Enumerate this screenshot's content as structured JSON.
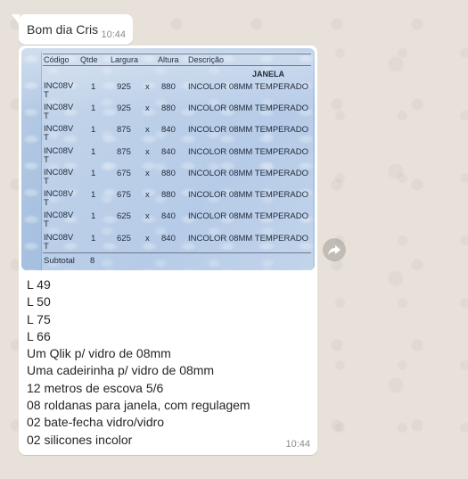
{
  "messages": [
    {
      "text": "Bom dia Cris",
      "time": "10:44"
    },
    {
      "image": {
        "headers": [
          "Código",
          "Qtde",
          "Largura",
          "Altura",
          "Descrição"
        ],
        "group_label": "JANELA",
        "rows": [
          {
            "code_line1": "INC08V",
            "code_line2": "T",
            "qty": "1",
            "width": "925",
            "x": "x",
            "height": "880",
            "desc": "INCOLOR 08MM TEMPERADO"
          },
          {
            "code_line1": "INC08V",
            "code_line2": "T",
            "qty": "1",
            "width": "925",
            "x": "x",
            "height": "880",
            "desc": "INCOLOR 08MM TEMPERADO"
          },
          {
            "code_line1": "INC08V",
            "code_line2": "T",
            "qty": "1",
            "width": "875",
            "x": "x",
            "height": "840",
            "desc": "INCOLOR 08MM TEMPERADO"
          },
          {
            "code_line1": "INC08V",
            "code_line2": "T",
            "qty": "1",
            "width": "875",
            "x": "x",
            "height": "840",
            "desc": "INCOLOR 08MM TEMPERADO"
          },
          {
            "code_line1": "INC08V",
            "code_line2": "T",
            "qty": "1",
            "width": "675",
            "x": "x",
            "height": "880",
            "desc": "INCOLOR 08MM TEMPERADO"
          },
          {
            "code_line1": "INC08V",
            "code_line2": "T",
            "qty": "1",
            "width": "675",
            "x": "x",
            "height": "880",
            "desc": "INCOLOR 08MM TEMPERADO"
          },
          {
            "code_line1": "INC08V",
            "code_line2": "T",
            "qty": "1",
            "width": "625",
            "x": "x",
            "height": "840",
            "desc": "INCOLOR 08MM TEMPERADO"
          },
          {
            "code_line1": "INC08V",
            "code_line2": "T",
            "qty": "1",
            "width": "625",
            "x": "x",
            "height": "840",
            "desc": "INCOLOR 08MM TEMPERADO"
          }
        ],
        "subtotal_label": "Subtotal",
        "subtotal_value": "8"
      },
      "lines": [
        "L 49",
        "L 50",
        "L 75",
        "L 66",
        "Um Qlik p/ vidro de 08mm",
        "Uma cadeirinha p/ vidro de 08mm",
        "12 metros de escova 5/6",
        "08 roldanas para janela, com regulagem",
        "02 bate-fecha vidro/vidro",
        "02 silicones incolor"
      ],
      "time": "10:44"
    }
  ],
  "forward_icon": "forward-arrow-icon",
  "colors": {
    "wallpaper": "#e8e1d9",
    "bubble": "#ffffff",
    "timestamp": "#8c8c8c",
    "photo_tint": "#a9c2e1"
  }
}
